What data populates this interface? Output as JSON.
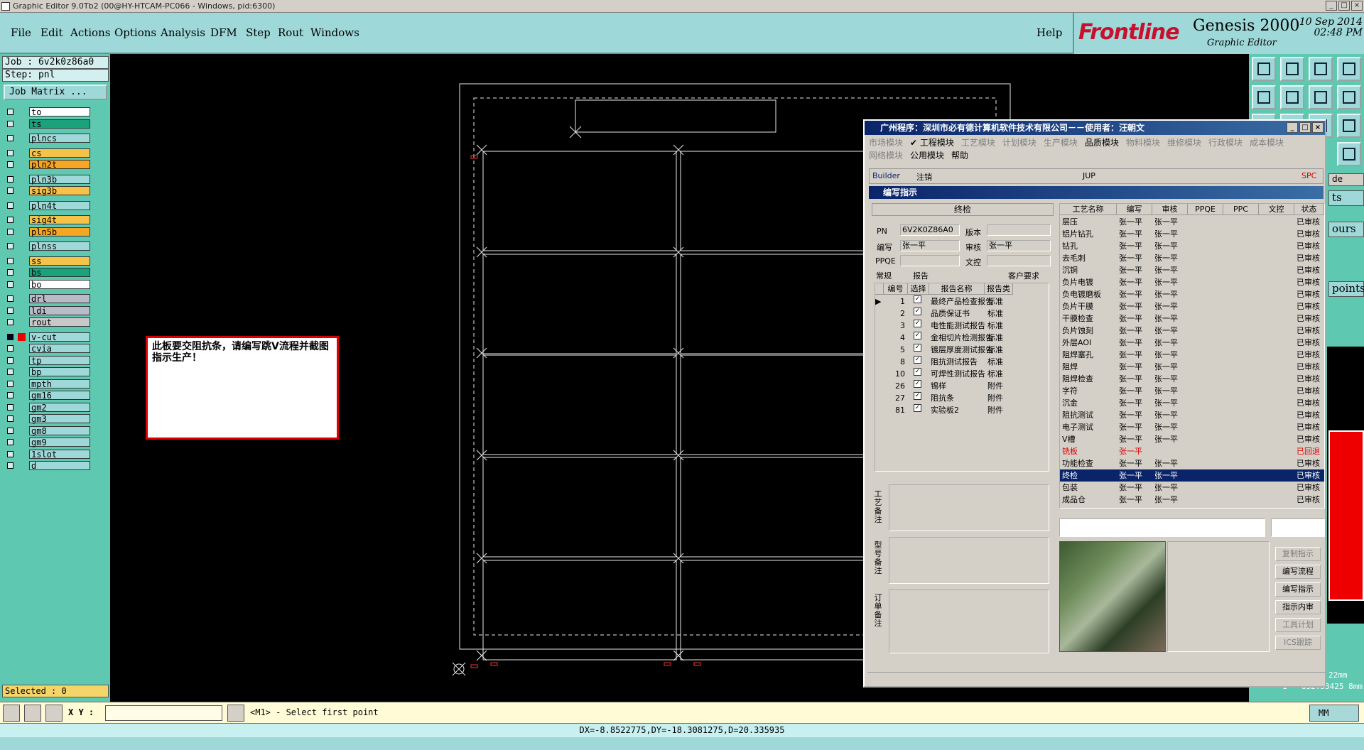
{
  "window": {
    "title": "Graphic Editor 9.0Tb2 (00@HY-HTCAM-PC066 - Windows, pid:6300)"
  },
  "menu": {
    "items": [
      "File",
      "Edit",
      "Actions",
      "Options",
      "Analysis",
      "DFM",
      "Step",
      "Rout",
      "Windows"
    ],
    "help": "Help"
  },
  "brand": {
    "logo": "Frontline",
    "product": "Genesis 2000",
    "subtitle": "Graphic Editor",
    "date": "10 Sep 2014",
    "time": "02:48 PM"
  },
  "job": {
    "job": "Job : 6v2k0z86a0",
    "step": "Step: pnl",
    "matrix_button": "Job Matrix ..."
  },
  "layers": [
    {
      "name": "to",
      "color": "#ffffff"
    },
    {
      "name": "ts",
      "color": "#1aa37a"
    },
    {
      "name": "plncs",
      "color": "#9fd8d8"
    },
    {
      "name": "cs",
      "color": "#f5c24a"
    },
    {
      "name": "pln2t",
      "color": "#f5a623"
    },
    {
      "name": "pln3b",
      "color": "#9fd8d8"
    },
    {
      "name": "sig3b",
      "color": "#f5c24a"
    },
    {
      "name": "pln4t",
      "color": "#9fd8d8"
    },
    {
      "name": "sig4t",
      "color": "#f5c24a"
    },
    {
      "name": "pln5b",
      "color": "#f5a623"
    },
    {
      "name": "plnss",
      "color": "#9fd8d8"
    },
    {
      "name": "ss",
      "color": "#f5c24a"
    },
    {
      "name": "bs",
      "color": "#1aa37a"
    },
    {
      "name": "bo",
      "color": "#ffffff"
    },
    {
      "name": "drl",
      "color": "#b8bcc8"
    },
    {
      "name": "ldi",
      "color": "#b8bcc8"
    },
    {
      "name": "rout",
      "color": "#c8c8c8"
    },
    {
      "name": "v-cut",
      "color": "#9fd8d8"
    },
    {
      "name": "cvia",
      "color": "#9fd8d8"
    },
    {
      "name": "tp",
      "color": "#9fd8d8"
    },
    {
      "name": "bp",
      "color": "#9fd8d8"
    },
    {
      "name": "mpth",
      "color": "#9fd8d8"
    },
    {
      "name": "gm16",
      "color": "#9fd8d8"
    },
    {
      "name": "gm2",
      "color": "#9fd8d8"
    },
    {
      "name": "gm3",
      "color": "#9fd8d8"
    },
    {
      "name": "gm8",
      "color": "#9fd8d8"
    },
    {
      "name": "gm9",
      "color": "#9fd8d8"
    },
    {
      "name": "1slot",
      "color": "#9fd8d8"
    },
    {
      "name": "d",
      "color": "#9fd8d8"
    }
  ],
  "selected": "Selected : 0",
  "note": "此板要交阻抗条，请编写跳V流程并截图指示生产！",
  "right_panel": {
    "labels": [
      "de",
      "ts",
      "ours",
      "points"
    ],
    "coord1": "22mm",
    "coord2": "I = 832.33425 8mm"
  },
  "dialog": {
    "title": "广州程序：深圳市必有德计算机软件技术有限公司－－使用者：汪朝文",
    "modules_row1": [
      "市场模块",
      "工程模块",
      "工艺模块",
      "计划模块",
      "生产模块",
      "品质模块",
      "物料模块",
      "维修模块",
      "行政模块",
      "成本模块"
    ],
    "modules_row2": [
      "网络模块",
      "公用模块",
      "帮助"
    ],
    "toolbar2": [
      "Builder",
      "注销",
      "JUP",
      "SPC"
    ],
    "subtitle": "编写指示",
    "section": "终检",
    "fields": {
      "pn_label": "PN",
      "pn": "6V2K0Z86A0",
      "version_label": "版本",
      "author_label": "编写",
      "author": "张一平",
      "reviewer_label": "审核",
      "reviewer": "张一平",
      "ppqe_label": "PPQE",
      "wk_label": "文控"
    },
    "tabs": [
      "常规",
      "报告",
      "客户要求"
    ],
    "report_headers": [
      "编号",
      "选择",
      "报告名称",
      "报告类"
    ],
    "reports": [
      {
        "no": "1",
        "name": "最终产品检查报告",
        "type": "标准"
      },
      {
        "no": "2",
        "name": "品质保证书",
        "type": "标准"
      },
      {
        "no": "3",
        "name": "电性能测试报告",
        "type": "标准"
      },
      {
        "no": "4",
        "name": "金相切片检测报告",
        "type": "标准"
      },
      {
        "no": "5",
        "name": "镀层厚度测试报告",
        "type": "标准"
      },
      {
        "no": "8",
        "name": "阻抗测试报告",
        "type": "标准"
      },
      {
        "no": "10",
        "name": "可焊性测试报告",
        "type": "标准"
      },
      {
        "no": "26",
        "name": "锡样",
        "type": "附件"
      },
      {
        "no": "27",
        "name": "阻抗条",
        "type": "附件"
      },
      {
        "no": "81",
        "name": "实验板2",
        "type": "附件"
      }
    ],
    "remarks": [
      "工艺备注",
      "型号备注",
      "订单备注"
    ],
    "process_headers": [
      "工艺名称",
      "编写",
      "审核",
      "PPQE",
      "PPC",
      "文控",
      "状态"
    ],
    "processes": [
      {
        "name": "层压",
        "a": "张一平",
        "b": "张一平",
        "s": "已审核"
      },
      {
        "name": "铝片钻孔",
        "a": "张一平",
        "b": "张一平",
        "s": "已审核"
      },
      {
        "name": "钻孔",
        "a": "张一平",
        "b": "张一平",
        "s": "已审核"
      },
      {
        "name": "去毛刺",
        "a": "张一平",
        "b": "张一平",
        "s": "已审核"
      },
      {
        "name": "沉铜",
        "a": "张一平",
        "b": "张一平",
        "s": "已审核"
      },
      {
        "name": "负片电镀",
        "a": "张一平",
        "b": "张一平",
        "s": "已审核"
      },
      {
        "name": "负电镀磨板",
        "a": "张一平",
        "b": "张一平",
        "s": "已审核"
      },
      {
        "name": "负片干膜",
        "a": "张一平",
        "b": "张一平",
        "s": "已审核"
      },
      {
        "name": "干膜检查",
        "a": "张一平",
        "b": "张一平",
        "s": "已审核"
      },
      {
        "name": "负片蚀刻",
        "a": "张一平",
        "b": "张一平",
        "s": "已审核"
      },
      {
        "name": "外层AOI",
        "a": "张一平",
        "b": "张一平",
        "s": "已审核"
      },
      {
        "name": "阻焊塞孔",
        "a": "张一平",
        "b": "张一平",
        "s": "已审核"
      },
      {
        "name": "阻焊",
        "a": "张一平",
        "b": "张一平",
        "s": "已审核"
      },
      {
        "name": "阻焊检查",
        "a": "张一平",
        "b": "张一平",
        "s": "已审核"
      },
      {
        "name": "字符",
        "a": "张一平",
        "b": "张一平",
        "s": "已审核"
      },
      {
        "name": "沉金",
        "a": "张一平",
        "b": "张一平",
        "s": "已审核"
      },
      {
        "name": "阻抗测试",
        "a": "张一平",
        "b": "张一平",
        "s": "已审核"
      },
      {
        "name": "电子测试",
        "a": "张一平",
        "b": "张一平",
        "s": "已审核"
      },
      {
        "name": "V槽",
        "a": "张一平",
        "b": "张一平",
        "s": "已审核"
      },
      {
        "name": "铣板",
        "a": "张一平",
        "b": "",
        "s": "已回退"
      },
      {
        "name": "功能检查",
        "a": "张一平",
        "b": "张一平",
        "s": "已审核"
      },
      {
        "name": "终检",
        "a": "张一平",
        "b": "张一平",
        "s": "已审核"
      },
      {
        "name": "包装",
        "a": "张一平",
        "b": "张一平",
        "s": "已审核"
      },
      {
        "name": "成品仓",
        "a": "张一平",
        "b": "张一平",
        "s": "已审核"
      }
    ],
    "action_buttons": [
      "复制指示",
      "编写流程",
      "编写指示",
      "指示内审",
      "工具计划",
      "ICS跟踪"
    ]
  },
  "cmd": {
    "xy_label": "X Y :",
    "prompt": "<M1> - Select first point",
    "units": "MM"
  },
  "status": "DX=-8.8522775,DY=-18.3081275,D=20.335935"
}
